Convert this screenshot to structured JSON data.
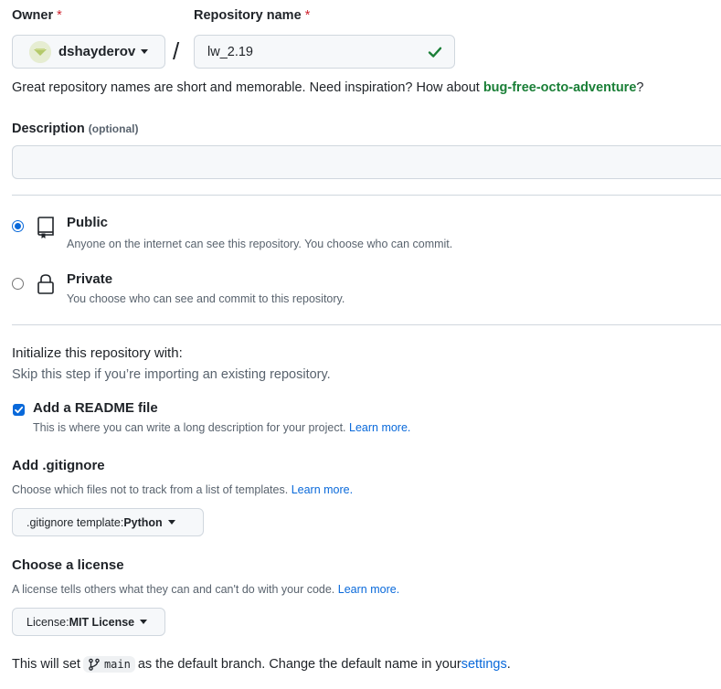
{
  "owner": {
    "label": "Owner",
    "required_mark": "*",
    "username": "dshayderov"
  },
  "repo": {
    "label": "Repository name",
    "required_mark": "*",
    "value": "lw_2.19",
    "separator": "/"
  },
  "hint": {
    "prefix": "Great repository names are short and memorable. Need inspiration? How about ",
    "suggestion": "bug-free-octo-adventure",
    "suffix": "?"
  },
  "description": {
    "label": "Description",
    "optional": "(optional)",
    "value": ""
  },
  "visibility": {
    "public": {
      "title": "Public",
      "desc": "Anyone on the internet can see this repository. You choose who can commit.",
      "selected": true
    },
    "private": {
      "title": "Private",
      "desc": "You choose who can see and commit to this repository.",
      "selected": false
    }
  },
  "init": {
    "heading": "Initialize this repository with:",
    "sub": "Skip this step if you’re importing an existing repository."
  },
  "readme": {
    "label": "Add a README file",
    "desc": "This is where you can write a long description for your project. ",
    "link": "Learn more.",
    "checked": true
  },
  "gitignore": {
    "heading": "Add .gitignore",
    "desc": "Choose which files not to track from a list of templates. ",
    "link": "Learn more.",
    "button_prefix": ".gitignore template: ",
    "button_value": "Python"
  },
  "license": {
    "heading": "Choose a license",
    "desc": "A license tells others what they can and can't do with your code. ",
    "link": "Learn more.",
    "button_prefix": "License: ",
    "button_value": "MIT License"
  },
  "branch": {
    "prefix": "This will set ",
    "name": "main",
    "middle": " as the default branch. Change the default name in your ",
    "link": "settings",
    "suffix": "."
  },
  "colors": {
    "accent": "#0969da",
    "success": "#1a7f37",
    "danger": "#cf222e",
    "suggestion": "#1a7f37"
  },
  "icons": {
    "repo": "repo-icon",
    "lock": "lock-icon",
    "branch": "git-branch-icon",
    "check": "check-icon",
    "avatar": "avatar"
  }
}
